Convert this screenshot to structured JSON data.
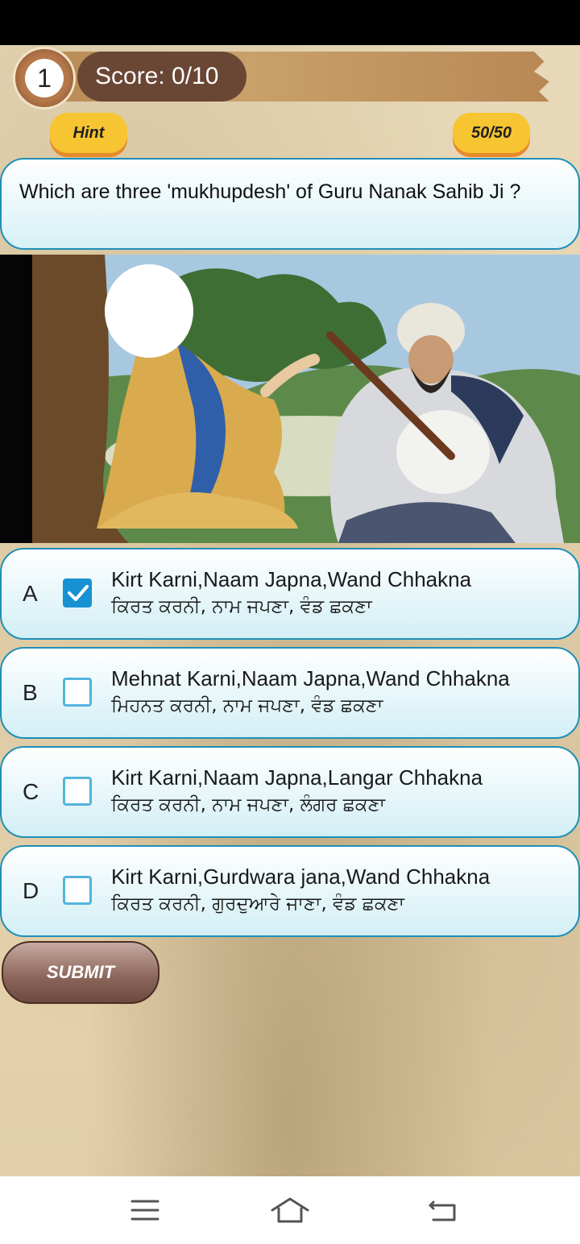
{
  "header": {
    "level": "1",
    "score_text": "Score: 0/10",
    "hint_label": "Hint",
    "timer_text": "50/50"
  },
  "question": {
    "text": "Which are three 'mukhupdesh' of Guru Nanak Sahib Ji ?"
  },
  "illustration": {
    "icon": "guru-nanak-and-rabab-player-illustration"
  },
  "options": [
    {
      "letter": "A",
      "english": "Kirt Karni,Naam Japna,Wand Chhakna",
      "punjabi": "ਕਿਰਤ ਕਰਨੀ, ਨਾਮ ਜਪਣਾ, ਵੰਡ ਛਕਣਾ",
      "checked": true
    },
    {
      "letter": "B",
      "english": "Mehnat Karni,Naam Japna,Wand Chhakna",
      "punjabi": "ਮਿਹਨਤ ਕਰਨੀ, ਨਾਮ ਜਪਣਾ, ਵੰਡ ਛਕਣਾ",
      "checked": false
    },
    {
      "letter": "C",
      "english": "Kirt Karni,Naam Japna,Langar Chhakna",
      "punjabi": "ਕਿਰਤ ਕਰਨੀ, ਨਾਮ ਜਪਣਾ, ਲੰਗਰ ਛਕਣਾ",
      "checked": false
    },
    {
      "letter": "D",
      "english": "Kirt Karni,Gurdwara jana,Wand Chhakna",
      "punjabi": "ਕਿਰਤ ਕਰਨੀ, ਗੁਰਦੁਆਰੇ ਜਾਣਾ, ਵੰਡ ਛਕਣਾ",
      "checked": false
    }
  ],
  "submit_label": "SUBMIT",
  "nav": {
    "menu_icon": "menu-icon",
    "home_icon": "home-icon",
    "back_icon": "back-icon"
  },
  "colors": {
    "accent_blue": "#1692d2",
    "card_border": "#1f8fb7",
    "hint_yellow": "#f7c531",
    "score_brown": "#6a4634"
  }
}
